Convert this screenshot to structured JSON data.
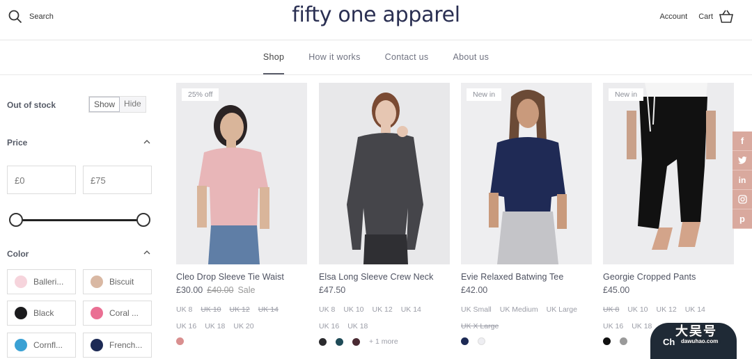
{
  "header": {
    "search_label": "Search",
    "logo": "fifty one apparel",
    "account_label": "Account",
    "cart_label": "Cart"
  },
  "nav": {
    "items": [
      "Shop",
      "How it works",
      "Contact us",
      "About us"
    ],
    "active": "Shop"
  },
  "filters": {
    "out_of_stock_label": "Out of stock",
    "show_label": "Show",
    "hide_label": "Hide",
    "price_label": "Price",
    "price_min": "£0",
    "price_max": "£75",
    "color_label": "Color",
    "colors": [
      {
        "name": "Balleri...",
        "hex": "#f6d4dc"
      },
      {
        "name": "Biscuit",
        "hex": "#d9b8a3"
      },
      {
        "name": "Black",
        "hex": "#1b1b1d"
      },
      {
        "name": "Coral ...",
        "hex": "#ea6f93"
      },
      {
        "name": "Cornfl...",
        "hex": "#3aa1d4"
      },
      {
        "name": "French...",
        "hex": "#1d2a55"
      }
    ]
  },
  "products": [
    {
      "badge": "25% off",
      "title": "Cleo Drop Sleeve Tie Waist",
      "price": "£30.00",
      "old_price": "£40.00",
      "sale_label": "Sale",
      "sizes": [
        "UK 8",
        "UK 10",
        "UK 12",
        "UK 14",
        "UK 16",
        "UK 18",
        "UK 20"
      ],
      "sizes_unavailable": [
        "UK 10",
        "UK 12",
        "UK 14"
      ],
      "swatches": [
        "#d98f8f"
      ],
      "more": ""
    },
    {
      "badge": "",
      "title": "Elsa Long Sleeve Crew Neck",
      "price": "£47.50",
      "sizes": [
        "UK 8",
        "UK 10",
        "UK 12",
        "UK 14",
        "UK 16",
        "UK 18"
      ],
      "sizes_unavailable": [],
      "swatches": [
        "#2b2b2e",
        "#1f4b57",
        "#4a2a33"
      ],
      "more": "+ 1 more"
    },
    {
      "badge": "New in",
      "title": "Evie Relaxed Batwing Tee",
      "price": "£42.00",
      "sizes": [
        "UK Small",
        "UK Medium",
        "UK Large",
        "UK X Large"
      ],
      "sizes_unavailable": [
        "UK X Large"
      ],
      "swatches": [
        "#1d2a55",
        "#eeeef2"
      ],
      "more": ""
    },
    {
      "badge": "New in",
      "title": "Georgie Cropped Pants",
      "price": "£45.00",
      "sizes": [
        "UK 8",
        "UK 10",
        "UK 12",
        "UK 14",
        "UK 16",
        "UK 18"
      ],
      "sizes_unavailable": [
        "UK 8"
      ],
      "swatches": [
        "#111111",
        "#9a9a9a"
      ],
      "more": ""
    }
  ],
  "social": [
    "f",
    "t",
    "in",
    "ig",
    "p"
  ],
  "chat": {
    "label": "Ch"
  },
  "watermark": {
    "title": "大吴号",
    "sub": "dawuhao.com"
  },
  "colors": {
    "accent_social": "#d9a99e",
    "chat_bg": "#1f2a36",
    "brand_text": "#2a2f52"
  }
}
